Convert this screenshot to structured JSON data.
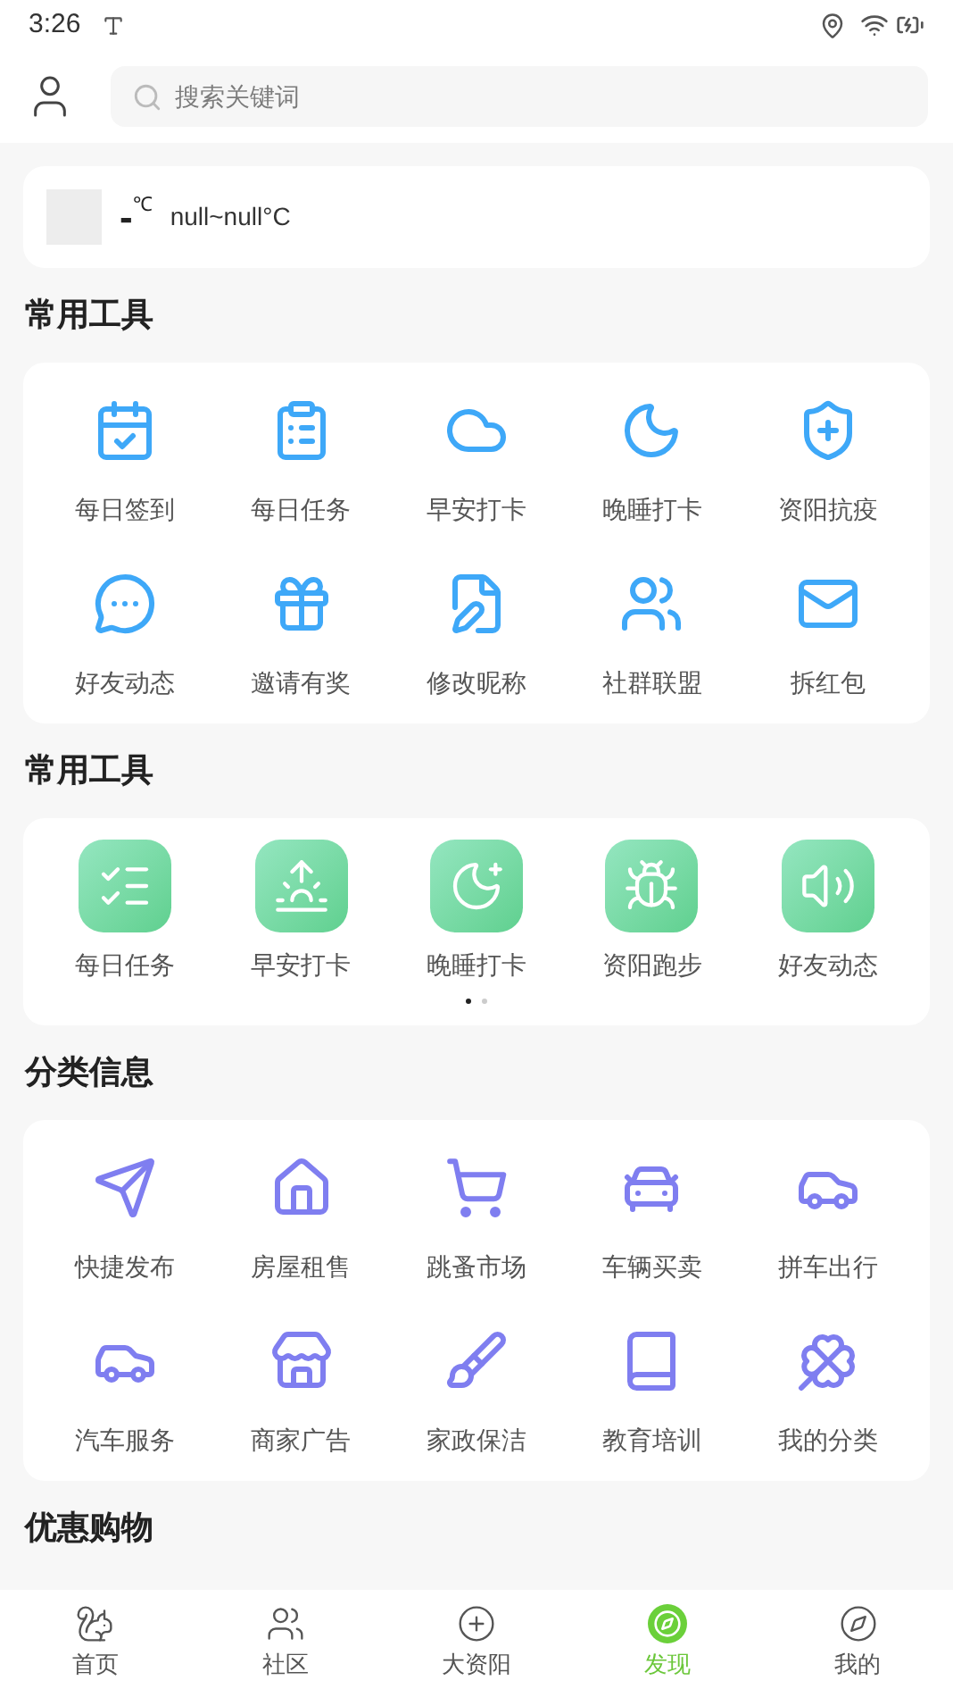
{
  "status_bar": {
    "time": "3:26"
  },
  "header": {
    "search": {
      "placeholder": "搜索关键词"
    }
  },
  "weather": {
    "temp": "-",
    "unit": "℃",
    "range": "null~null°C"
  },
  "sections": [
    {
      "title": "常用工具",
      "kind": "blue",
      "items": [
        {
          "label": "每日签到"
        },
        {
          "label": "每日任务"
        },
        {
          "label": "早安打卡"
        },
        {
          "label": "晚睡打卡"
        },
        {
          "label": "资阳抗疫"
        },
        {
          "label": "好友动态"
        },
        {
          "label": "邀请有奖"
        },
        {
          "label": "修改昵称"
        },
        {
          "label": "社群联盟"
        },
        {
          "label": "拆红包"
        }
      ]
    },
    {
      "title": "常用工具",
      "kind": "green",
      "items": [
        {
          "label": "每日任务"
        },
        {
          "label": "早安打卡"
        },
        {
          "label": "晚睡打卡"
        },
        {
          "label": "资阳跑步"
        },
        {
          "label": "好友动态"
        }
      ],
      "pages": [
        {
          "selected": true
        },
        {
          "selected": false
        }
      ]
    },
    {
      "title": "分类信息",
      "kind": "purple",
      "items": [
        {
          "label": "快捷发布"
        },
        {
          "label": "房屋租售"
        },
        {
          "label": "跳蚤市场"
        },
        {
          "label": "车辆买卖"
        },
        {
          "label": "拼车出行"
        },
        {
          "label": "汽车服务"
        },
        {
          "label": "商家广告"
        },
        {
          "label": "家政保洁"
        },
        {
          "label": "教育培训"
        },
        {
          "label": "我的分类"
        }
      ]
    },
    {
      "title": "优惠购物"
    }
  ],
  "bottom_nav": [
    {
      "label": "首页",
      "selected": false
    },
    {
      "label": "社区",
      "selected": false
    },
    {
      "label": "大资阳",
      "selected": false
    },
    {
      "label": "发现",
      "selected": true
    },
    {
      "label": "我的",
      "selected": false
    }
  ]
}
